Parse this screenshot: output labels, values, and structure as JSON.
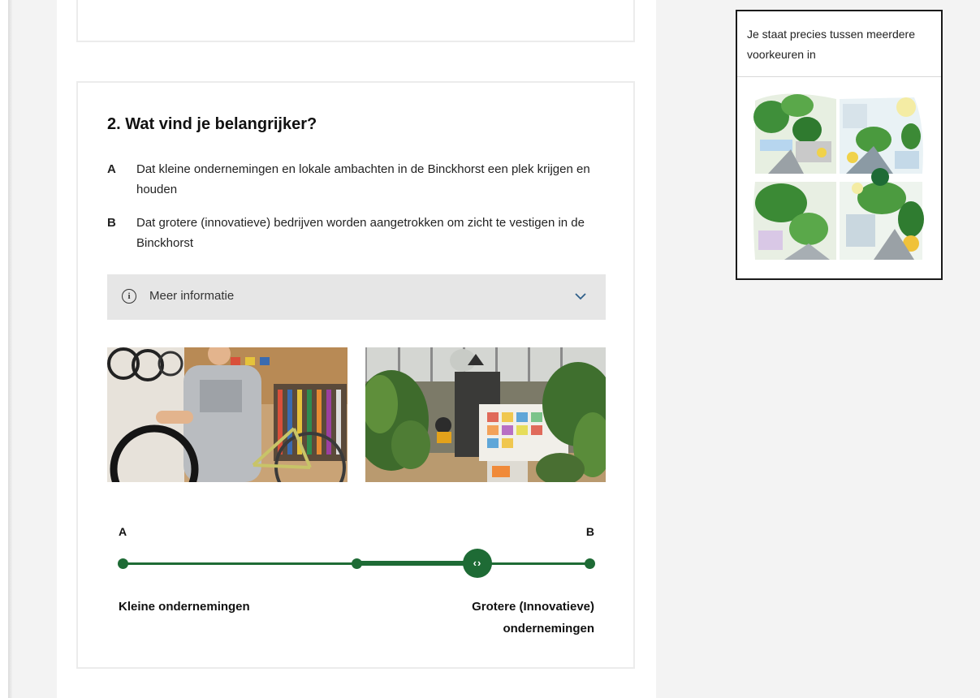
{
  "question": {
    "title": "2. Wat vind je belangrijker?",
    "options": [
      {
        "key": "A",
        "text": "Dat kleine ondernemingen en lokale ambachten in de Binckhorst een plek krijgen en houden"
      },
      {
        "key": "B",
        "text": "Dat grotere (innovatieve) bedrijven worden aangetrokken om zicht te vestigen in de Binckhorst"
      }
    ],
    "more_info": {
      "icon": "info-icon",
      "label": "Meer informatie",
      "expand_icon": "chevron-down-icon",
      "expanded": false
    },
    "images": [
      {
        "name": "photo-bike-workshop"
      },
      {
        "name": "photo-office-plants"
      }
    ]
  },
  "slider": {
    "left_end": "A",
    "right_end": "B",
    "left_caption": "Kleine ondernemingen",
    "right_caption_line1": "Grotere (Innovatieve)",
    "right_caption_line2": "ondernemingen",
    "value": 0.76,
    "range_start": 0.5,
    "thumb_icon": "drag-arrows-icon",
    "accent_color": "#1e6b35"
  },
  "result": {
    "text": "Je staat precies tussen meerdere voorkeuren in",
    "marker_color": "#1e6b35"
  }
}
